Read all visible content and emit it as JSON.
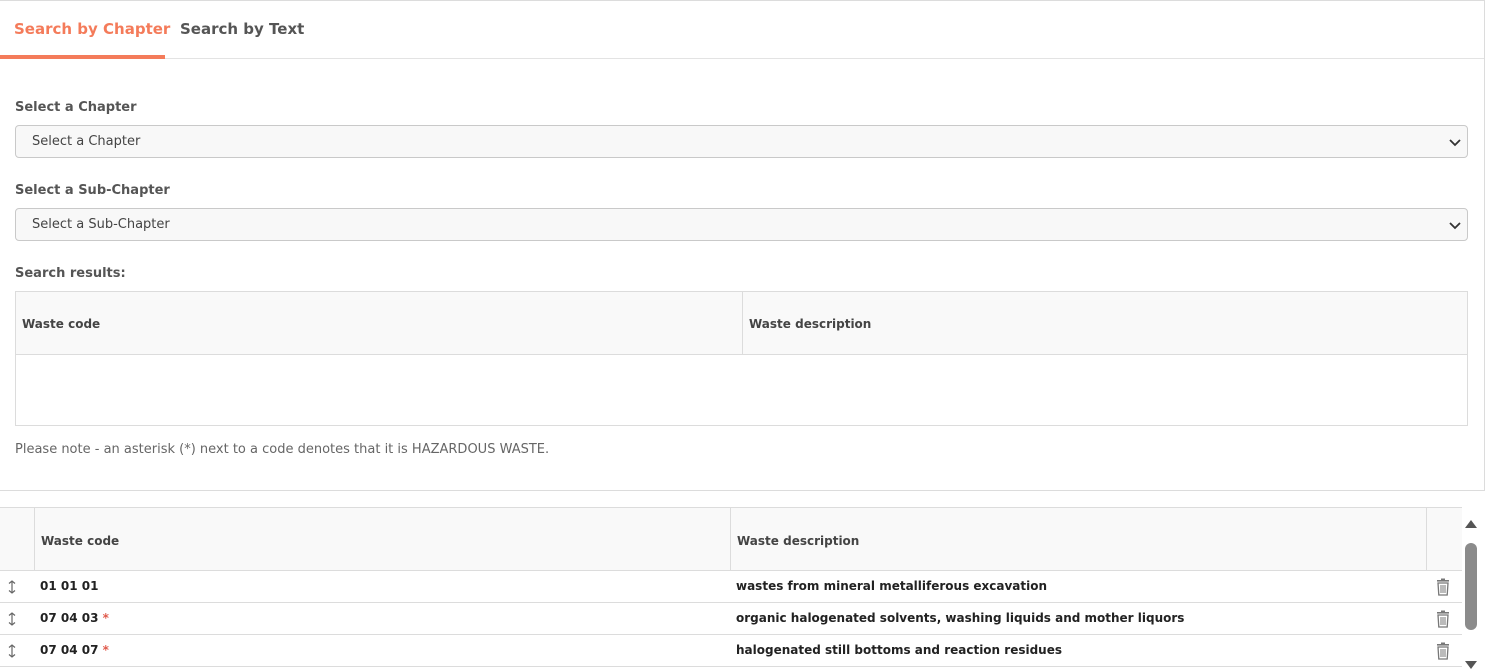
{
  "tabs": [
    {
      "label": "Search by Chapter",
      "active": true
    },
    {
      "label": "Search by Text",
      "active": false
    }
  ],
  "chapter": {
    "label": "Select a Chapter",
    "selected": "Select a Chapter"
  },
  "subchapter": {
    "label": "Select a Sub-Chapter",
    "selected": "Select a Sub-Chapter"
  },
  "search_results": {
    "label": "Search results:",
    "columns": [
      "Waste code",
      "Waste description"
    ],
    "rows": []
  },
  "note": "Please note - an asterisk (*) next to a code denotes that it is HAZARDOUS WASTE.",
  "selected_list": {
    "columns": [
      "Waste code",
      "Waste description"
    ],
    "rows": [
      {
        "code": "01 01 01",
        "hazardous": "",
        "description": "wastes from mineral metalliferous excavation"
      },
      {
        "code": "07 04 03",
        "hazardous": "*",
        "description": "organic halogenated solvents, washing liquids and mother liquors"
      },
      {
        "code": "07 04 07",
        "hazardous": "*",
        "description": "halogenated still bottoms and reaction residues"
      }
    ]
  },
  "colors": {
    "accent": "#f47b5a",
    "hazard": "#e05a4c"
  }
}
